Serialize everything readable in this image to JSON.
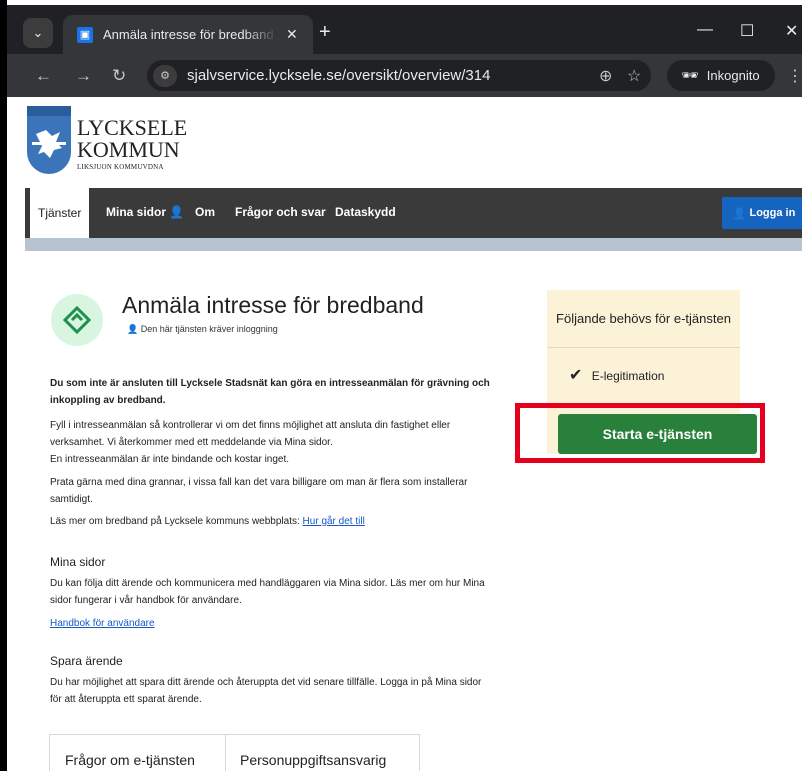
{
  "browser": {
    "tab_title": "Anmäla intresse för bredband -",
    "url": "sjalvservice.lycksele.se/oversikt/overview/314",
    "incognito_label": "Inkognito"
  },
  "logo": {
    "line1": "LYCKSELE",
    "line2": "KOMMUN",
    "line3": "LIKSJUON KOMMUVDNA"
  },
  "nav": {
    "items": [
      "Tjänster",
      "Mina sidor",
      "Om",
      "Frågor och svar",
      "Dataskydd"
    ],
    "login_label": "Logga in"
  },
  "service": {
    "title": "Anmäla intresse för bredband",
    "login_required": "Den här tjänsten kräver inloggning",
    "intro_bold": "Du som inte är ansluten till Lycksele Stadsnät kan göra en intresseanmälan för grävning och inkoppling av bredband.",
    "p1": "Fyll i intresseanmälan så kontrollerar vi om det finns möjlighet att ansluta din fastighet eller verksamhet. Vi återkommer med ett meddelande via Mina sidor.",
    "p1b": "En intresseanmälan är inte bindande och kostar inget.",
    "p2": "Prata gärna med dina grannar, i vissa fall kan det vara billigare om man är flera som installerar samtidigt.",
    "p3": "Läs mer om bredband på Lycksele kommuns webbplats:",
    "p3_link": "Hur går det till",
    "mina_sidor_heading": "Mina sidor",
    "mina_sidor_text": "Du kan följa ditt ärende och kommunicera med handläggaren via Mina sidor. Läs mer om hur Mina sidor fungerar i vår handbok för användare.",
    "handbook_link": "Handbok för användare",
    "spara_heading": "Spara ärende",
    "spara_text": "Du har möjlighet att spara ditt ärende och återuppta det vid senare tillfälle. Logga in på Mina sidor för att återuppta ett sparat ärende."
  },
  "requirements": {
    "title": "Följande behövs för e-tjänsten",
    "item": "E-legitimation",
    "start_label": "Starta e-tjänsten"
  },
  "bottom_tabs": [
    "Frågor om e-tjänsten",
    "Personuppgiftsansvarig"
  ],
  "colors": {
    "start_button": "#28803a",
    "highlight": "#e5001e",
    "nav_bg": "#3a3a3a",
    "login_bg": "#1565c0"
  }
}
